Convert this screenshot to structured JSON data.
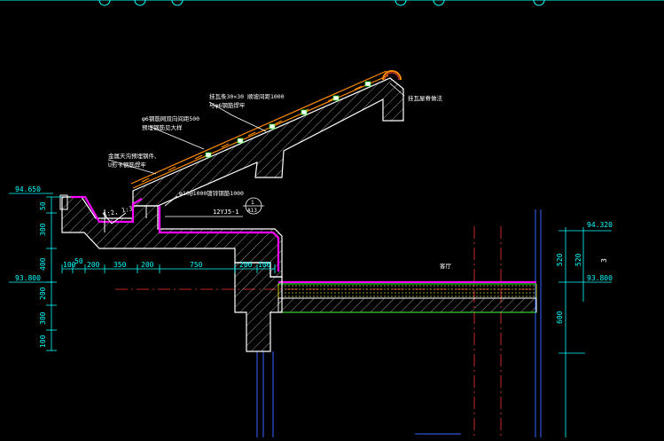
{
  "colors": {
    "background": "#000000",
    "concrete": "#ffffff",
    "hatch": "#ffffff",
    "waterproof": "#ff00ff",
    "tile": "#ff8c00",
    "annotation": "#00ffff",
    "dimension": "#00ffff",
    "grid": "#0000ff",
    "red_axis": "#ff0000",
    "insulation": "#ffff00",
    "green_layer": "#00ff00"
  },
  "elevations": {
    "left_top": "94.650",
    "left_mid": "93.800",
    "right_top": "94.320",
    "right_mid": "93.800"
  },
  "dims_left_vertical": [
    "50",
    "300",
    "400",
    "200",
    "300",
    "100"
  ],
  "dims_bottom": [
    "100",
    "50",
    "200",
    "350",
    "200",
    "750",
    "200",
    "100"
  ],
  "dims_right_vertical": [
    "520",
    "520",
    "600"
  ],
  "notes": {
    "n1_line1": "挂瓦条30×30 顺坡间距1000",
    "n1_line2": "与φ6钢筋焊牢",
    "n2_line1": "φ6钢筋网双向间距500",
    "n2_line2": "预埋钢筋见大样",
    "n3_line1": "金属天沟预埋钢件、",
    "n3_line2": "U形卡钢筋焊牢",
    "n4": "φ10@1000镀锌钢筋1000",
    "n5": "挂瓦屋脊做法",
    "ref_code": "12YJ5-1",
    "ref_circle_top": "1",
    "ref_circle_bottom": "A13",
    "slope": "1:2, 1:3",
    "room": "客厅",
    "r_label": "3"
  }
}
